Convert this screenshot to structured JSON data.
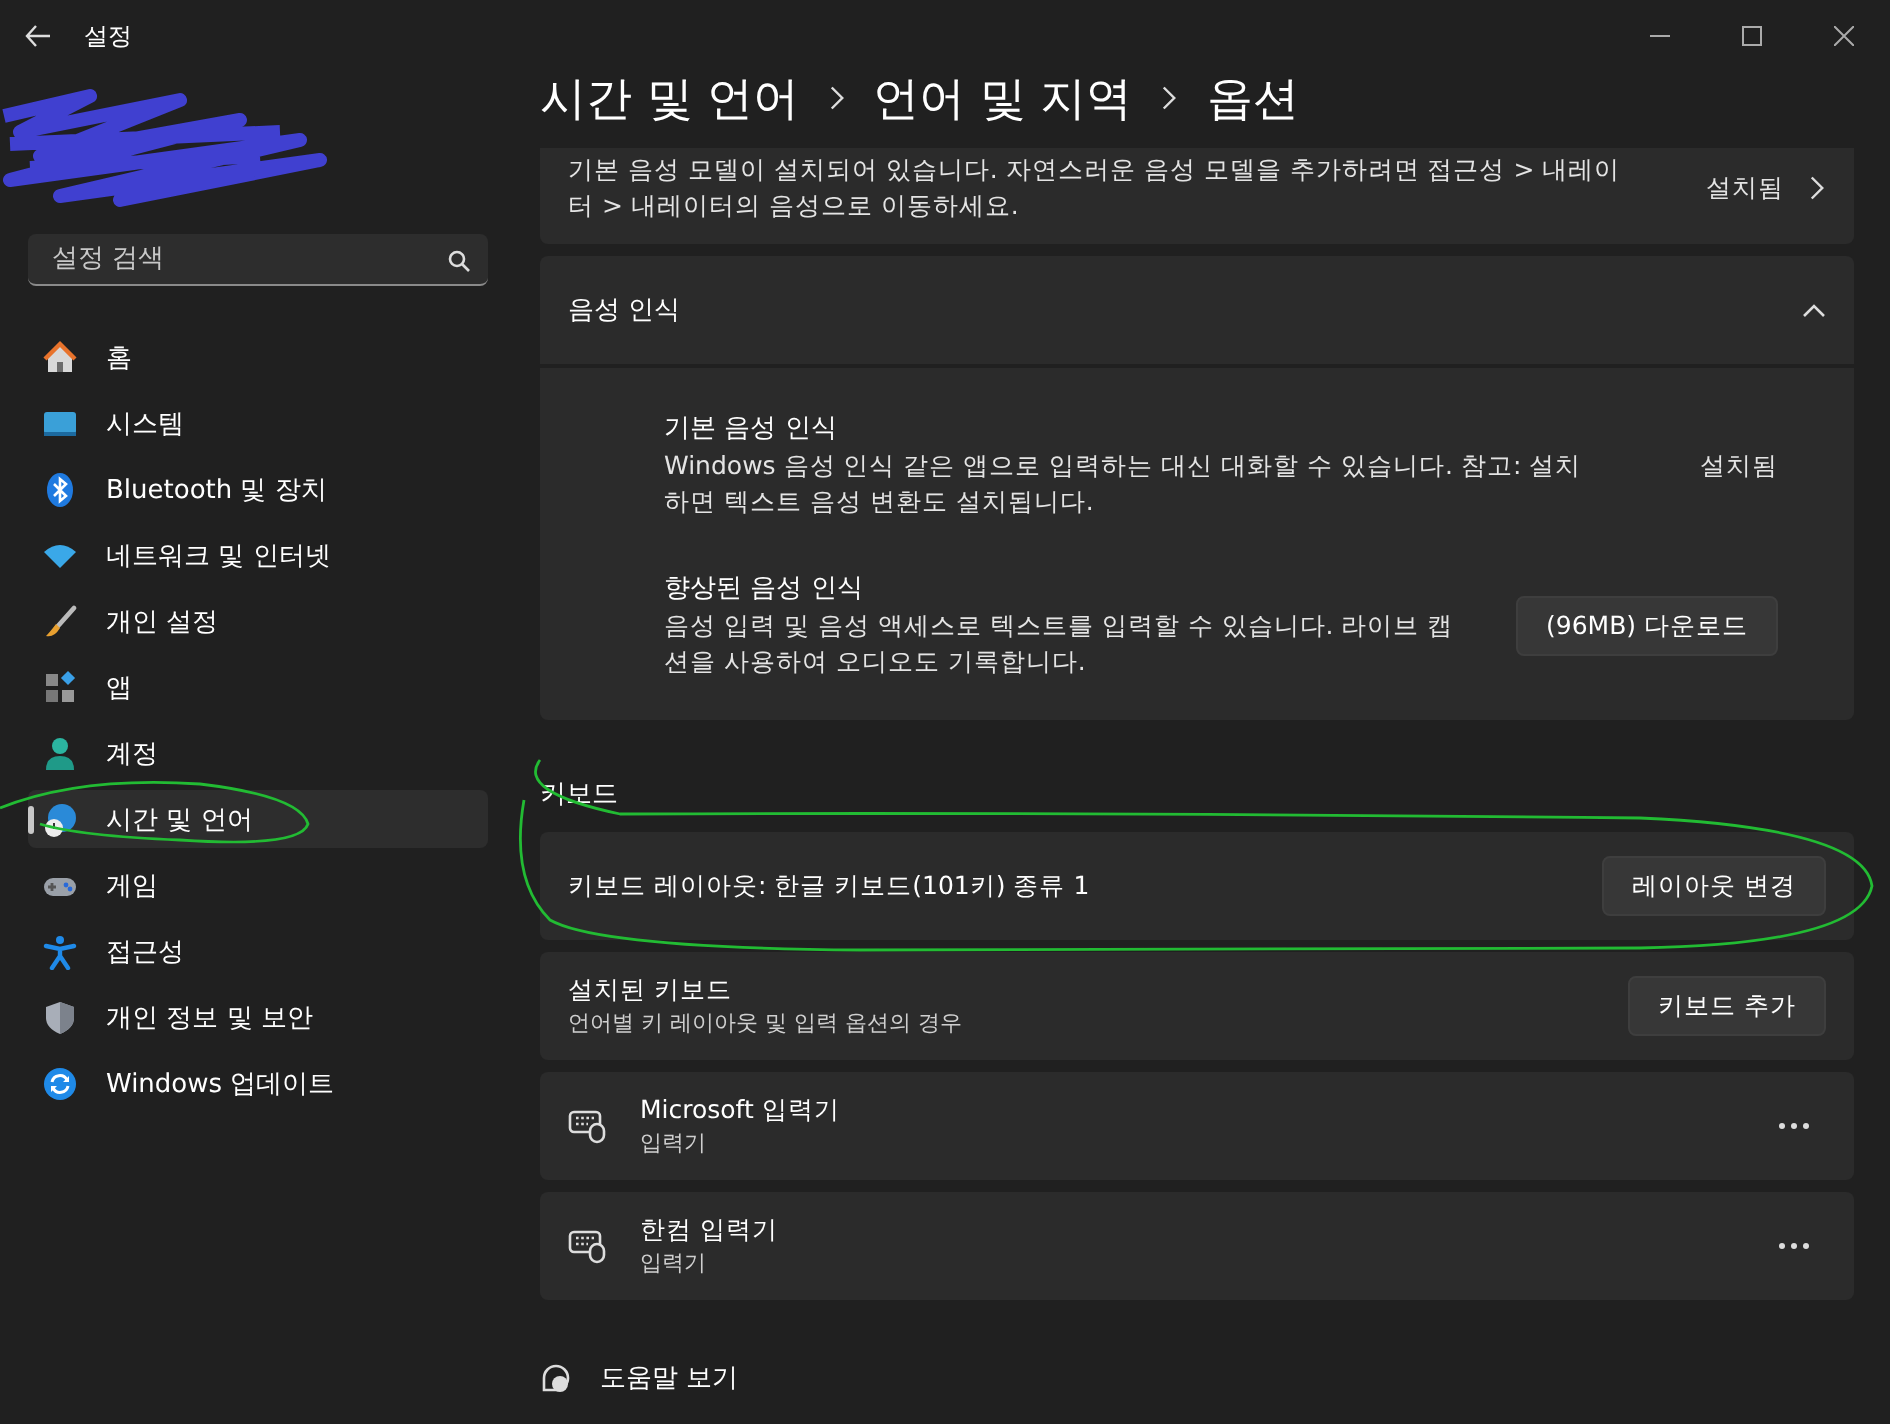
{
  "window": {
    "title": "설정"
  },
  "sidebar": {
    "search": {
      "placeholder": "설정 검색"
    },
    "items": [
      {
        "label": "홈",
        "selected": false
      },
      {
        "label": "시스템",
        "selected": false
      },
      {
        "label": "Bluetooth 및 장치",
        "selected": false
      },
      {
        "label": "네트워크 및 인터넷",
        "selected": false
      },
      {
        "label": "개인 설정",
        "selected": false
      },
      {
        "label": "앱",
        "selected": false
      },
      {
        "label": "계정",
        "selected": false
      },
      {
        "label": "시간 및 언어",
        "selected": true
      },
      {
        "label": "게임",
        "selected": false
      },
      {
        "label": "접근성",
        "selected": false
      },
      {
        "label": "개인 정보 및 보안",
        "selected": false
      },
      {
        "label": "Windows 업데이트",
        "selected": false
      }
    ]
  },
  "breadcrumb": [
    "시간 및 언어",
    "언어 및 지역",
    "옵션"
  ],
  "tts_card": {
    "description": "기본 음성 모델이 설치되어 있습니다. 자연스러운 음성 모델을 추가하려면 접근성 > 내레이터 > 내레이터의 음성으로 이동하세요.",
    "status": "설치됨"
  },
  "speech_section": {
    "title": "음성 인식",
    "expanded": true,
    "items": [
      {
        "kind": "status",
        "title": "기본 음성 인식",
        "description": "Windows 음성 인식 같은 앱으로 입력하는 대신 대화할 수 있습니다. 참고: 설치하면 텍스트 음성 변환도 설치됩니다.",
        "status": "설치됨"
      },
      {
        "kind": "button",
        "title": "향상된 음성 인식",
        "description": "음성 입력 및 음성 액세스로 텍스트를 입력할 수 있습니다. 라이브 캡션을 사용하여 오디오도 기록합니다.",
        "button": "(96MB) 다운로드"
      }
    ]
  },
  "keyboard_section": {
    "heading": "키보드",
    "layout_row": {
      "label": "키보드 레이아웃: 한글 키보드(101키) 종류 1",
      "button": "레이아웃 변경"
    },
    "installed_row": {
      "title": "설치된 키보드",
      "subtitle": "언어별 키 레이아웃 및 입력 옵션의 경우",
      "button": "키보드 추가"
    },
    "input_methods": [
      {
        "name": "Microsoft 입력기",
        "type": "입력기"
      },
      {
        "name": "한컴 입력기",
        "type": "입력기"
      }
    ]
  },
  "help_link": "도움말 보기"
}
